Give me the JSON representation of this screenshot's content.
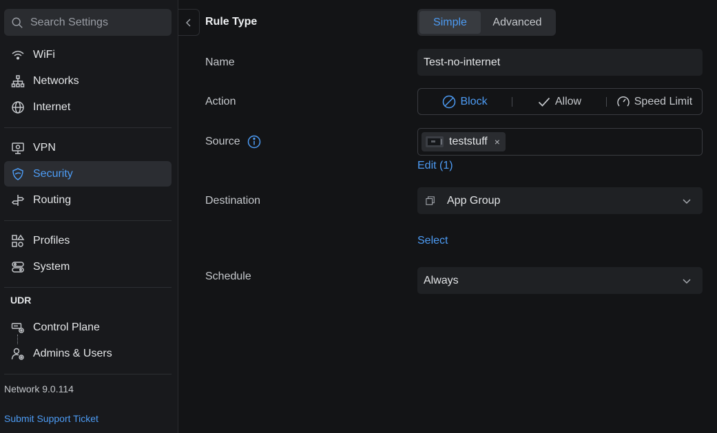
{
  "sidebar": {
    "search_placeholder": "Search Settings",
    "groups": [
      {
        "items": [
          {
            "label": "WiFi",
            "icon": "wifi-icon"
          },
          {
            "label": "Networks",
            "icon": "networks-icon"
          },
          {
            "label": "Internet",
            "icon": "globe-icon"
          }
        ]
      },
      {
        "items": [
          {
            "label": "VPN",
            "icon": "vpn-icon"
          },
          {
            "label": "Security",
            "icon": "shield-icon",
            "active": true
          },
          {
            "label": "Routing",
            "icon": "routing-icon"
          }
        ]
      },
      {
        "items": [
          {
            "label": "Profiles",
            "icon": "profiles-icon"
          },
          {
            "label": "System",
            "icon": "system-icon"
          }
        ]
      }
    ],
    "section_title": "UDR",
    "udr_items": [
      {
        "label": "Control Plane",
        "icon": "control-plane-icon"
      },
      {
        "label": "Admins & Users",
        "icon": "admins-icon"
      }
    ],
    "version": "Network 9.0.114",
    "support_link": "Submit Support Ticket"
  },
  "form": {
    "rule_type": {
      "label": "Rule Type",
      "options": [
        "Simple",
        "Advanced"
      ],
      "selected": "Simple"
    },
    "name": {
      "label": "Name",
      "value": "Test-no-internet"
    },
    "action": {
      "label": "Action",
      "options": [
        "Block",
        "Allow",
        "Speed Limit"
      ],
      "selected": "Block"
    },
    "source": {
      "label": "Source",
      "chip": "teststuff",
      "chip_remove": "×",
      "edit_link": "Edit (1)"
    },
    "destination": {
      "label": "Destination",
      "value": "App Group",
      "select_link": "Select"
    },
    "schedule": {
      "label": "Schedule",
      "value": "Always"
    }
  },
  "colors": {
    "accent": "#4d9cf5",
    "background": "#131416",
    "sidebar": "#18191c"
  }
}
